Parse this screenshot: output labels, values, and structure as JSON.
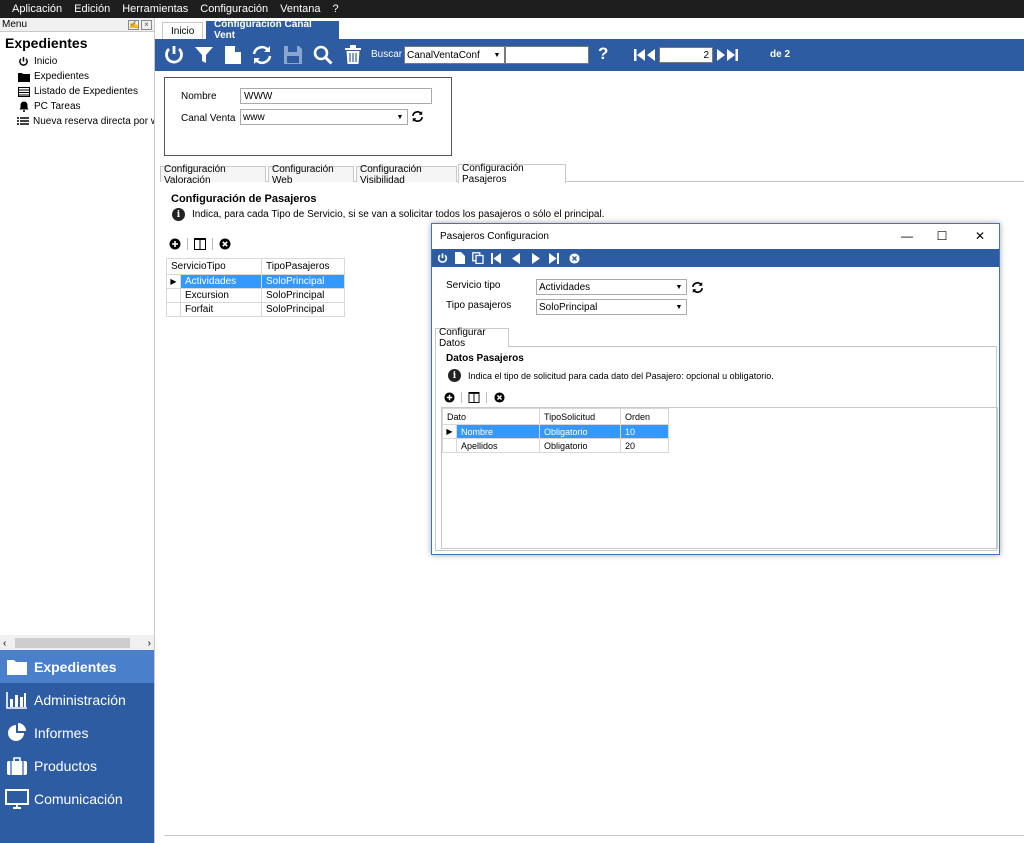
{
  "menubar": {
    "items": [
      "Aplicación",
      "Edición",
      "Herramientas",
      "Configuración",
      "Ventana",
      "?"
    ]
  },
  "sidebar": {
    "menu_label": "Menu",
    "title": "Expedientes",
    "tree": [
      {
        "label": "Inicio",
        "icon": "power-icon"
      },
      {
        "label": "Expedientes",
        "icon": "folder-icon"
      },
      {
        "label": "Listado de Expedientes",
        "icon": "list-table-icon"
      },
      {
        "label": "PC Tareas",
        "icon": "bell-icon"
      },
      {
        "label": "Nueva reserva directa por w",
        "icon": "list-icon"
      }
    ],
    "nav": [
      {
        "label": "Expedientes",
        "icon": "folder-icon",
        "active": true
      },
      {
        "label": "Administración",
        "icon": "bar-chart-icon",
        "active": false
      },
      {
        "label": "Informes",
        "icon": "pie-chart-icon",
        "active": false
      },
      {
        "label": "Productos",
        "icon": "suitcase-icon",
        "active": false
      },
      {
        "label": "Comunicación",
        "icon": "monitor-icon",
        "active": false
      }
    ]
  },
  "doc_tabs": {
    "home": "Inicio",
    "active": "Configuración Canal Vent"
  },
  "toolbar": {
    "buscar_label": "Buscar",
    "search_combo_value": "CanalVentaConf",
    "search_text": "",
    "help": "?",
    "page_current": "2",
    "page_total_label": "de 2"
  },
  "form": {
    "nombre_label": "Nombre",
    "nombre_value": "WWW",
    "canal_label": "Canal Venta",
    "canal_value": "www"
  },
  "subtabs": [
    "Configuración Valoración",
    "Configuración Web",
    "Configuración Visibilidad",
    "Configuración Pasajeros"
  ],
  "pasajeros": {
    "title": "Configuración de Pasajeros",
    "info": "Indica, para cada Tipo de Servicio, si se van a solicitar todos los pasajeros o sólo el principal.",
    "columns": [
      "ServicioTipo",
      "TipoPasajeros"
    ],
    "rows": [
      [
        "Actividades",
        "SoloPrincipal"
      ],
      [
        "Excursion",
        "SoloPrincipal"
      ],
      [
        "Forfait",
        "SoloPrincipal"
      ]
    ]
  },
  "dialog": {
    "title": "Pasajeros Configuracion",
    "servicio_label": "Servicio tipo",
    "servicio_value": "Actividades",
    "tipo_label": "Tipo pasajeros",
    "tipo_value": "SoloPrincipal",
    "tab": "Configurar Datos",
    "section_title": "Datos Pasajeros",
    "info": "Indica el tipo de solicitud para cada dato del Pasajero: opcional u obligatorio.",
    "columns": [
      "Dato",
      "TipoSolicitud",
      "Orden"
    ],
    "rows": [
      [
        "Nombre",
        "Obligatorio",
        "10"
      ],
      [
        "Apellidos",
        "Obligatorio",
        "20"
      ]
    ]
  },
  "colors": {
    "accent": "#2d5ca3",
    "selection": "#3399ff",
    "menubar": "#1e1e1e"
  }
}
